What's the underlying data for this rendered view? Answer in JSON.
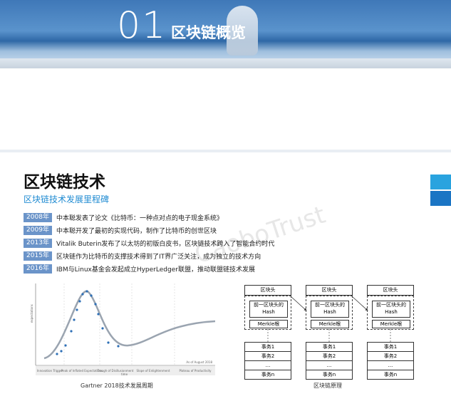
{
  "banner": {
    "number": "01",
    "title": "区块链概览"
  },
  "section": {
    "title": "区块链技术",
    "subtitle": "区块链技术发展里程碑"
  },
  "timeline": [
    {
      "year": "2008年",
      "text": "中本聪发表了论文《比特币：一种点对点的电子现金系统》"
    },
    {
      "year": "2009年",
      "text": "中本聪开发了最初的实现代码，制作了比特币的创世区块"
    },
    {
      "year": "2013年",
      "text": "Vitalik Buterin发布了以太坊的初版白皮书，区块链技术跨入了智能合约时代"
    },
    {
      "year": "2015年",
      "text": "区块链作为比特币的支撑技术得到了IT界广泛关注，成为独立的技术方向"
    },
    {
      "year": "2016年",
      "text": "IBM与Linux基金会发起成立HyperLedger联盟，推动联盟链技术发展"
    }
  ],
  "watermark": {
    "text": "CaoboTrust"
  },
  "hype_chart": {
    "caption": "Gartner 2018技术发展周期",
    "ylabel": "expectations",
    "xlabel": "time",
    "phases": [
      "Innovation Trigger",
      "Peak of Inflated Expectations",
      "Trough of Disillusionment",
      "Slope of Enlightenment",
      "Plateau of Productivity"
    ],
    "date": "As of August 2018"
  },
  "blockchain": {
    "caption": "区块链原理",
    "blocks": [
      {
        "head": "区块头",
        "prev_hash": "前一区块头的Hash",
        "merkle": "Merkle根",
        "txs": [
          "事务1",
          "事务2",
          "...",
          "事务n"
        ]
      },
      {
        "head": "区块头",
        "prev_hash": "前一区块头的Hash",
        "merkle": "Merkle根",
        "txs": [
          "事务1",
          "事务2",
          "...",
          "事务n"
        ]
      },
      {
        "head": "区块头",
        "prev_hash": "前一区块头的Hash",
        "merkle": "Merkle根",
        "txs": [
          "事务1",
          "事务2",
          "...",
          "事务n"
        ]
      }
    ]
  }
}
